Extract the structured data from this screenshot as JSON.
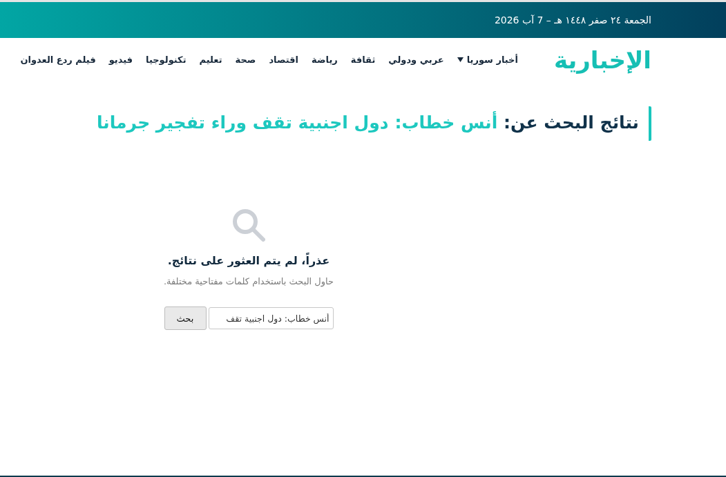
{
  "top_bar": {
    "date": "الجمعة ٢٤ صفر ١٤٤٨ هـ – 7 آب 2026"
  },
  "header": {
    "logo": "الإخبارية",
    "nav": [
      {
        "label": "أخبار سوريا",
        "dropdown": true
      },
      {
        "label": "عربي ودولي",
        "dropdown": false
      },
      {
        "label": "ثقافة",
        "dropdown": false
      },
      {
        "label": "رياضة",
        "dropdown": false
      },
      {
        "label": "اقتصاد",
        "dropdown": false
      },
      {
        "label": "صحة",
        "dropdown": false
      },
      {
        "label": "تعليم",
        "dropdown": false
      },
      {
        "label": "تكنولوجيا",
        "dropdown": false
      },
      {
        "label": "فيديو",
        "dropdown": false
      },
      {
        "label": "فيلم ردع العدوان",
        "dropdown": false
      }
    ]
  },
  "results_heading": {
    "label": "نتائج البحث عن:",
    "query": "أنس خطاب: دول اجنبية تقف وراء تفجير جرمانا"
  },
  "empty_state": {
    "title": "عذراً، لم يتم العثور على نتائج.",
    "message": "حاول البحث باستخدام كلمات مفتاحية مختلفة.",
    "search": {
      "value": "أنس خطاب: دول اجنبية تقف",
      "button": "بحث"
    }
  }
}
